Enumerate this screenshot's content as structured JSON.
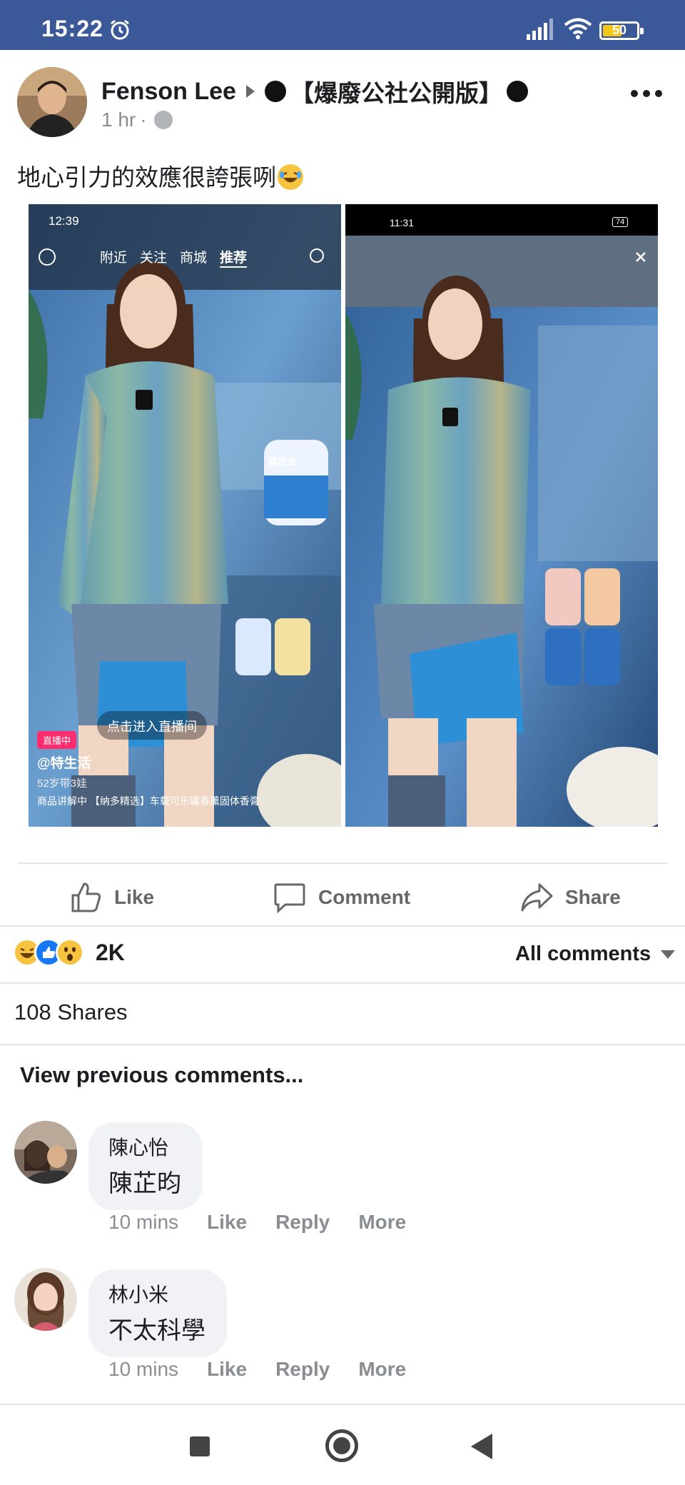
{
  "status_bar": {
    "time": "15:22",
    "battery": "50"
  },
  "post": {
    "author": "Fenson Lee",
    "group": "【爆廢公社公開版】",
    "time": "1 hr",
    "meta_separator": "·",
    "text": "地心引力的效應很誇張咧",
    "left_screenshot": {
      "time": "12:39",
      "tabs": [
        "附近",
        "关注",
        "商城",
        "推荐"
      ],
      "product_label": "真古龙",
      "cta": "点击进入直播间",
      "live_badge": "直播中",
      "handle": "@特生活",
      "subtitle": "52岁带3娃",
      "ticker": "商品讲解中   【纳多精选】车载可乐罐香薰固体香膏..."
    },
    "right_screenshot": {
      "time": "11:31",
      "battery": "74"
    }
  },
  "actions": {
    "like": "Like",
    "comment": "Comment",
    "share": "Share"
  },
  "stats": {
    "reaction_count": "2K",
    "all_comments": "All comments",
    "shares": "108 Shares"
  },
  "comments_section": {
    "view_previous": "View previous comments..."
  },
  "comments": [
    {
      "name": "陳心怡",
      "text": "陳芷昀",
      "time": "10 mins",
      "like": "Like",
      "reply": "Reply",
      "more": "More"
    },
    {
      "name": "林小米",
      "text": "不太科學",
      "time": "10 mins",
      "like": "Like",
      "reply": "Reply",
      "more": "More"
    }
  ],
  "colors": {
    "status_bar": "#3b5998",
    "text_primary": "#1c1e21",
    "text_secondary": "#65676b",
    "bubble_bg": "#f0f2f5"
  }
}
